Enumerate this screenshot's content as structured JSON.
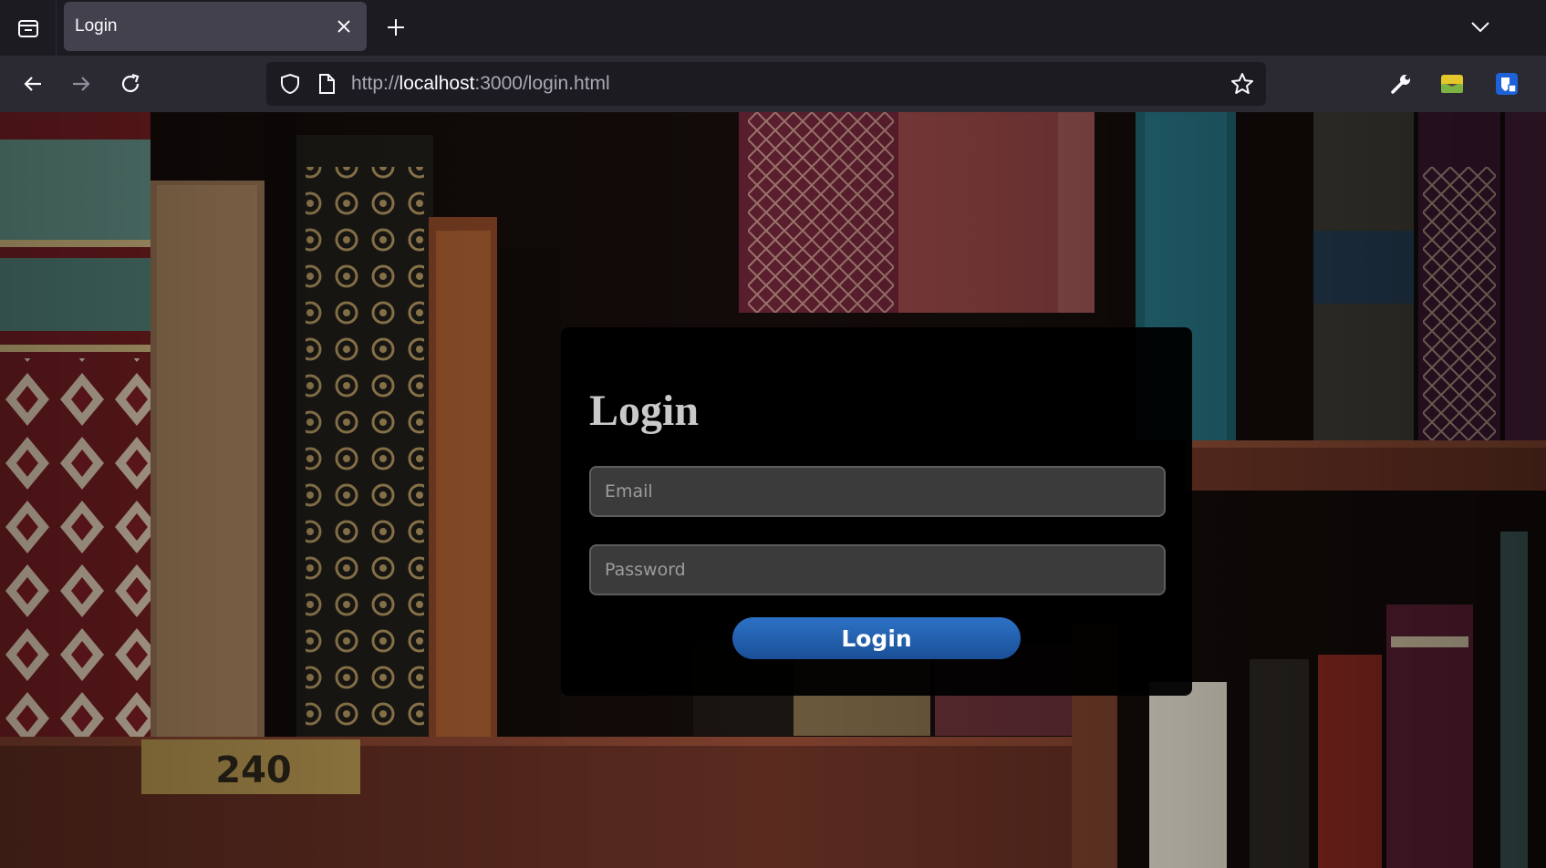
{
  "browser": {
    "tab": {
      "title": "Login",
      "close_icon": "close-icon"
    },
    "url": {
      "protocol": "http://",
      "host": "localhost",
      "rest": ":3000/login.html"
    },
    "icons": {
      "tab_list": "tab-list-icon",
      "new_tab": "plus-icon",
      "overflow": "chevron-down-icon",
      "back": "back-arrow-icon",
      "forward": "forward-arrow-icon",
      "reload": "reload-icon",
      "shield": "shield-icon",
      "page": "page-icon",
      "bookmark": "star-icon",
      "devtools": "wrench-icon",
      "extension_1": "extension-landscape-icon",
      "extension_2": "extension-shield-icon"
    }
  },
  "page": {
    "background": "bookshelf photo",
    "shelf_label": "240",
    "login": {
      "heading": "Login",
      "email_placeholder": "Email",
      "password_placeholder": "Password",
      "button_label": "Login"
    }
  },
  "colors": {
    "chrome_dark": "#1c1b22",
    "chrome_mid": "#2b2a33",
    "tab_active": "#42414d",
    "button_blue": "#1f5fae"
  }
}
